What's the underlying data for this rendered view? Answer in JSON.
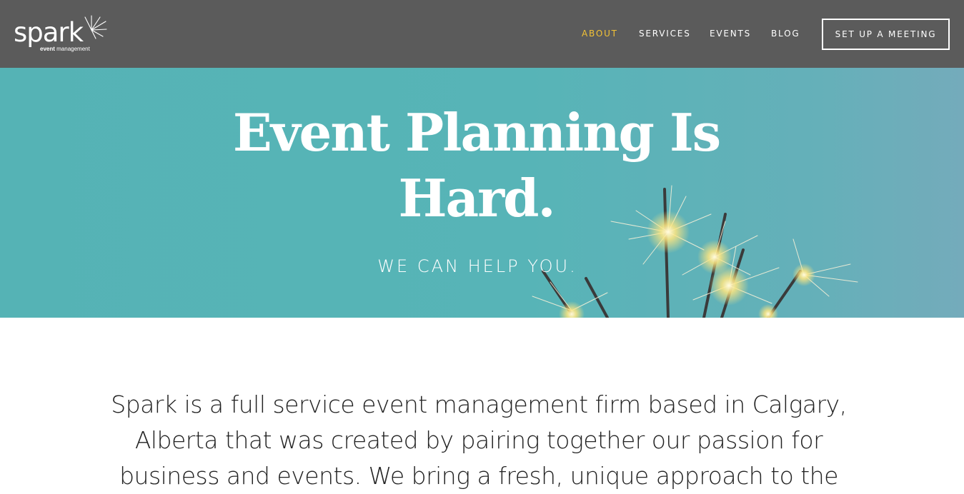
{
  "header": {
    "logo": {
      "word": "spark",
      "sub_bold": "event",
      "sub_rest": " management",
      "icon": "sparkle-icon"
    },
    "nav": [
      {
        "label": "ABOUT",
        "active": true
      },
      {
        "label": "SERVICES",
        "active": false
      },
      {
        "label": "EVENTS",
        "active": false
      },
      {
        "label": "BLOG",
        "active": false
      }
    ],
    "cta_label": "SET UP A MEETING"
  },
  "hero": {
    "title": "Event Planning Is Hard.",
    "subtitle": "WE CAN HELP YOU."
  },
  "intro": {
    "text": "Spark is a full service event management firm based in Calgary, Alberta that was created by pairing together our passion for business and events. We bring a fresh, unique approach to the"
  },
  "colors": {
    "header_bg": "#5b5b5b",
    "accent": "#f2c236",
    "hero_bg": "#55b3b5",
    "text": "#222222"
  }
}
